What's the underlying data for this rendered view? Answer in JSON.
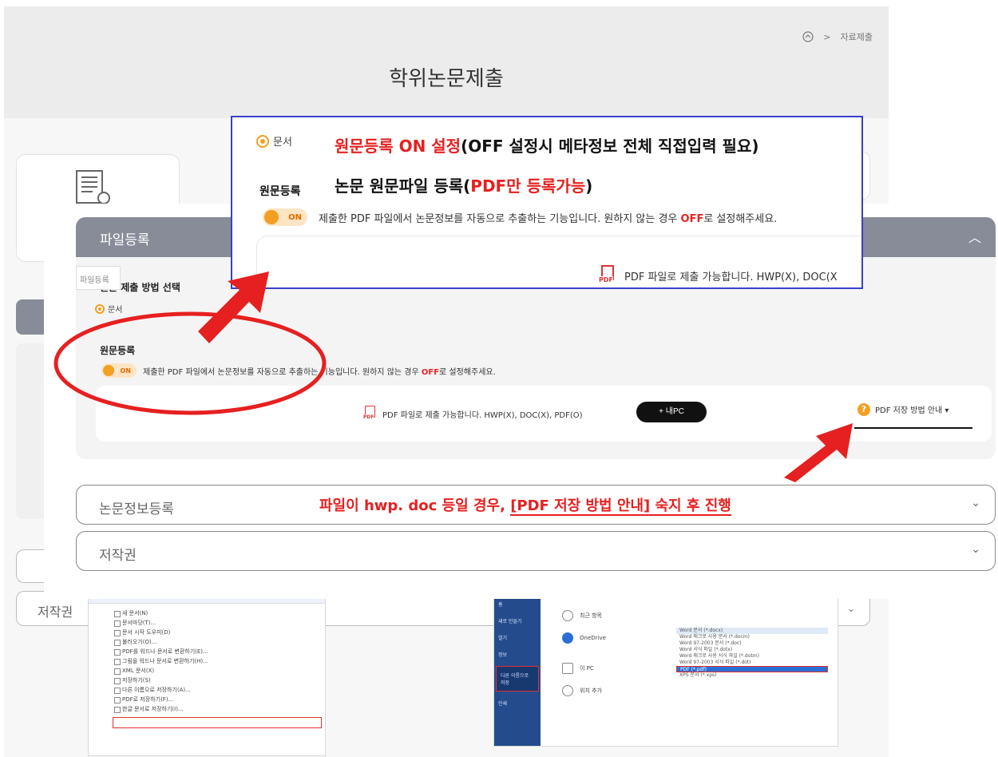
{
  "breadcrumb": {
    "current": "자료제출"
  },
  "page": {
    "title": "학위논문제출"
  },
  "background": {
    "copyright_label": "저작권",
    "menu_items": [
      "새 문서(N)",
      "문서마당(T)...",
      "문서 시작 도우미(D)",
      "불러오기(O)...",
      "PDF를 워드나 문서로 변환하기(E)...",
      "그림을 워드나 문서로 변환하기(H)...",
      "XML 문서(X)",
      "저장하기(S)",
      "다른 이름으로 저장하기(A)...",
      "PDF로 저장하기(F)...",
      "한글 문서로 저장하기(I)..."
    ],
    "save_sidebar": [
      "홈",
      "새로 만들기",
      "열기",
      "정보",
      "다른 이름으로 저장",
      "인쇄"
    ],
    "save_items": [
      "최근 항목",
      "OneDrive",
      "이 PC",
      "위치 추가"
    ],
    "save_list": [
      "Word 문서 (*.docx)",
      "Word 매크로 사용 문서 (*.docm)",
      "Word 97-2003 문서 (*.doc)",
      "Word 서식 파일 (*.dotx)",
      "Word 매크로 사용 서식 파일 (*.dotm)",
      "Word 97-2003 서식 파일 (*.dot)",
      "PDF (*.pdf)",
      "XPS 문서 (*.xps)"
    ]
  },
  "file_registration": {
    "title": "파일등록",
    "tooltip": "파일등록",
    "method_label": "원문 제출 방법 선택",
    "radio_label": "문서",
    "original_label": "원문등록",
    "toggle_label": "ON",
    "toggle_desc_before": "제출한 PDF 파일에서 논문정보를 자동으로 추출하는 기능입니다. 원하지 않는 경우 ",
    "toggle_desc_off": "OFF",
    "toggle_desc_after": "로 설정해주세요.",
    "upload_text": "PDF 파일로 제출 가능합니다. HWP(X), DOC(X), PDF(O)",
    "add_pc_button": "+ 내PC",
    "pdf_guide": "PDF 저장 방법 안내 ▾"
  },
  "accordions": {
    "thesis_info": "논문정보등록",
    "copyright": "저작권"
  },
  "annotation": {
    "hwp_note_before": "파일이 hwp. doc 등일 경우, ",
    "hwp_note_bracket": "[PDF 저장 방법 안내] 숙지 후 진행"
  },
  "zoom": {
    "radio_label": "문서",
    "heading1_red": "원문등록 ON 설정",
    "heading1_rest": "(OFF 설정시 메타정보 전체 직접입력 필요)",
    "heading2_start": "논문 원문파일 등록(",
    "heading2_red": "PDF만 등록가능",
    "heading2_end": ")",
    "label": "원문등록",
    "toggle_label": "ON",
    "toggle_desc_before": "제출한 PDF 파일에서 논문정보를 자동으로 추출하는 기능입니다. 원하지 않는 경우 ",
    "toggle_desc_off": "OFF",
    "toggle_desc_after": "로 설정해주세요.",
    "upload_text": "PDF 파일로 제출 가능합니다. HWP(X), DOC(X"
  },
  "icons": {
    "home": "home-icon",
    "chevron_up": "chevron-up-icon",
    "chevron_down": "chevron-down-icon",
    "pdf": "pdf-icon",
    "question": "question-icon",
    "document": "document-icon"
  },
  "colors": {
    "accent": "#f2a021",
    "highlight_red": "#e62020",
    "callout_border": "#3a40c8",
    "header_bar": "#888c98"
  }
}
